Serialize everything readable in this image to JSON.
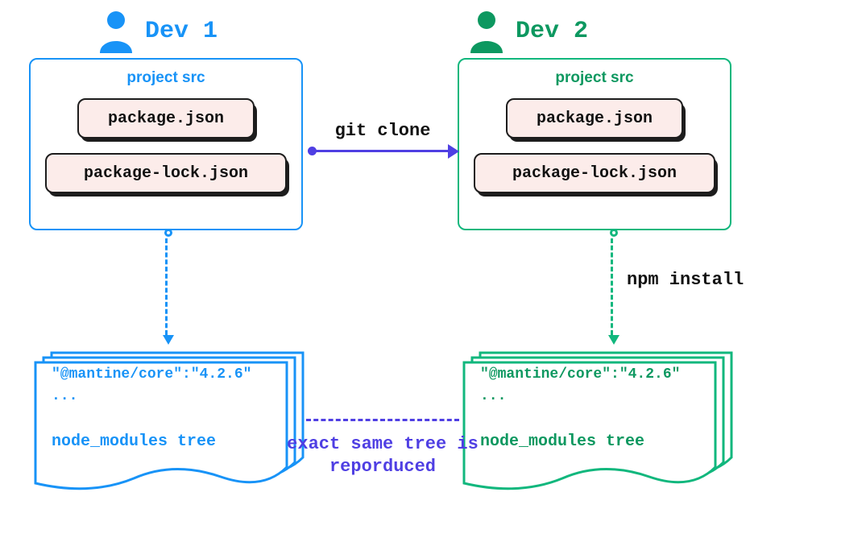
{
  "dev1": {
    "label": "Dev 1",
    "color": "#1893f7",
    "project_src_label": "project src",
    "file1": "package.json",
    "file2": "package-lock.json",
    "dep_line": "\"@mantine/core\":\"4.2.6\"",
    "dep_ellipsis": "...",
    "tree_label": "node_modules tree"
  },
  "dev2": {
    "label": "Dev 2",
    "color": "#0d9860",
    "project_src_label": "project src",
    "file1": "package.json",
    "file2": "package-lock.json",
    "dep_line": "\"@mantine/core\":\"4.2.6\"",
    "dep_ellipsis": "...",
    "tree_label": "node_modules tree"
  },
  "arrows": {
    "git_clone": "git clone",
    "npm_install": "npm install"
  },
  "caption": "exact same tree is reporduced",
  "colors": {
    "blue": "#1893f7",
    "green": "#11b77d",
    "green_text": "#0d9860",
    "purple": "#4f3fe3",
    "pill_bg": "#fcecea",
    "pill_border": "#1d1d1d"
  }
}
